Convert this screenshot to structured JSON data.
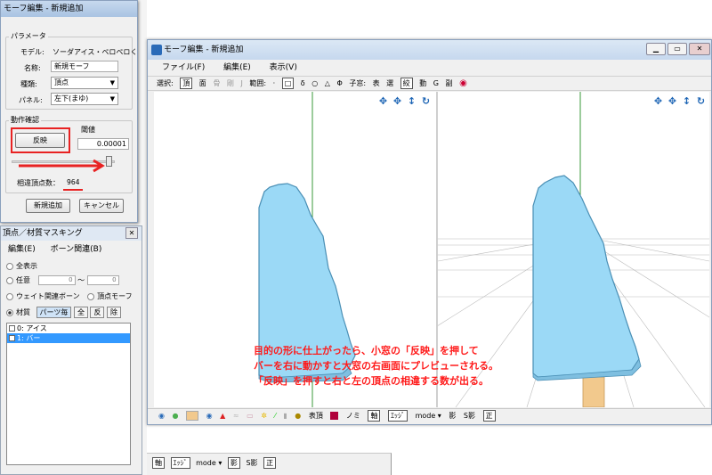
{
  "small_dialog": {
    "title": "モーフ編集 - 新規追加",
    "group_params": "パラメータ",
    "model_label": "モデル:",
    "model_value": "ソーダアイス・ペロペロくん",
    "name_label": "名称:",
    "name_value": "新規モーフ",
    "type_label": "種類:",
    "type_value": "頂点",
    "panel_label": "パネル:",
    "panel_value": "左下(まゆ)",
    "group_confirm": "動作確認",
    "apply_button": "反映",
    "threshold_label": "閾値",
    "threshold_value": "0.00001",
    "diff_label": "相違頂点数：",
    "diff_value": "964",
    "add_button": "新規追加",
    "cancel_button": "キャンセル"
  },
  "mask_window": {
    "title": "頂点／材質マスキング",
    "menu": [
      "編集(E)",
      "ボーン関連(B)"
    ],
    "opt_all": "全表示",
    "opt_any": "任意",
    "any_from": "0",
    "tilde": "〜",
    "any_to": "0",
    "opt_weight": "ウェイト関連ボーン",
    "opt_vertex_morph": "頂点モーフ",
    "opt_material": "材質",
    "btn_parts": "パーツ毎",
    "btn_all": "全",
    "btn_invert": "反",
    "btn_remove": "除",
    "items": [
      "0: アイス",
      "1: バー"
    ]
  },
  "main_window": {
    "title": "モーフ編集 - 新規追加",
    "menu": [
      "ファイル(F)",
      "編集(E)",
      "表示(V)"
    ],
    "toolbar": {
      "select": "選択:",
      "vertex": "頂",
      "face": "面",
      "bone": "骨",
      "rigid": "剛",
      "joint": "J",
      "range": "範囲:",
      "child": "子窓:",
      "front": "表",
      "pick": "選",
      "twist": "絞",
      "move": "動",
      "g": "G",
      "copy": "副"
    },
    "bottom": {
      "front": "表頂",
      "no": "ノミ",
      "axis": "軸",
      "edge": "ｴｯｼﾞ",
      "mode": "mode ▾",
      "shadow": "影",
      "s_shadow": "S影",
      "correct": "正"
    }
  },
  "bottom_strip": {
    "axis": "軸",
    "edge": "ｴｯｼﾞ",
    "mode": "mode ▾",
    "shadow": "影",
    "s_shadow": "S影",
    "correct": "正"
  },
  "annotation": {
    "line1": "目的の形に仕上がったら、小窓の「反映」を押して",
    "line2": "バーを右に動かすと大窓の右画面にプレビューされる。",
    "line3": "「反映」を押すと右と左の頂点の相違する数が出る。"
  },
  "colors": {
    "ice": "#9bd9f6",
    "ice_outline": "#4a8fb5",
    "bar": "#f2c98d",
    "highlight": "#e82222",
    "annotation": "#ff1a1a"
  }
}
